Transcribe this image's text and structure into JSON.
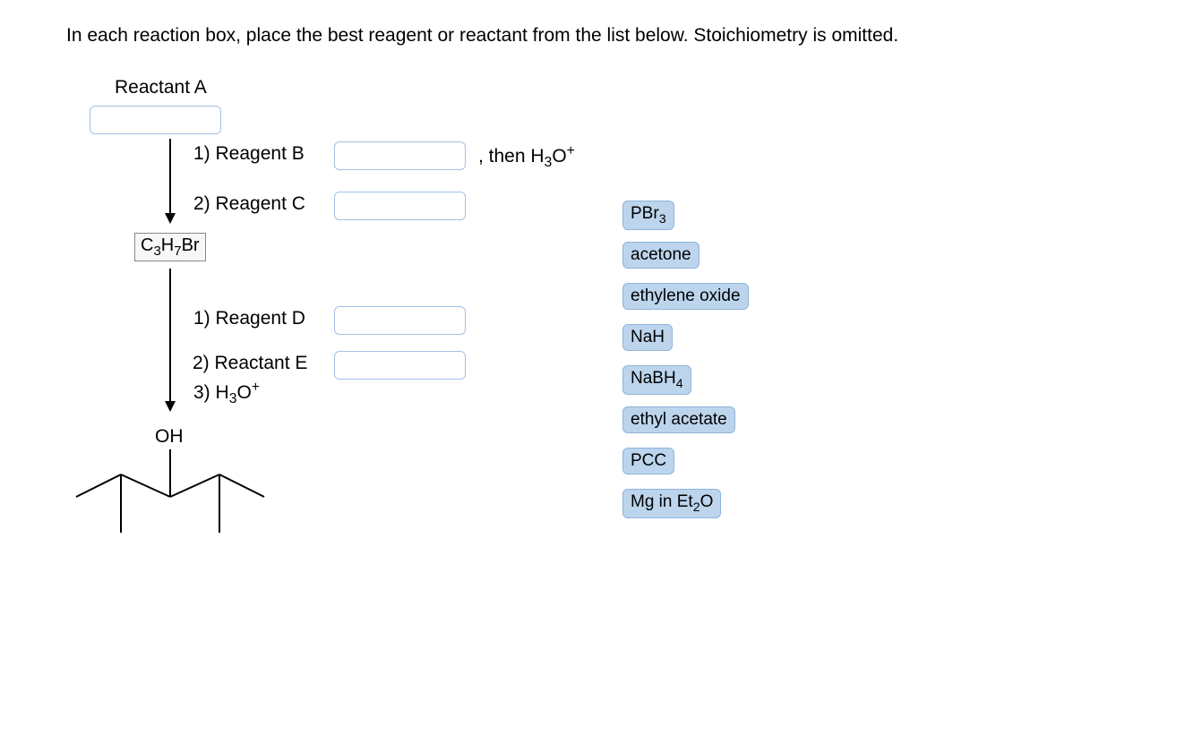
{
  "instruction": "In each reaction box, place the best reagent or reactant from the list below. Stoichiometry is omitted.",
  "labels": {
    "reactant_a": "Reactant A",
    "step_b_prefix": "1) Reagent B",
    "step_b_suffix": ", then H₃O⁺",
    "step_c": "2) Reagent C",
    "intermediate": "C₃H₇Br",
    "step_d": "1) Reagent D",
    "step_e": "2) Reactant E",
    "step_f": "3) H₃O⁺",
    "product_oh": "OH"
  },
  "reagent_bank": [
    "PBr₃",
    "acetone",
    "ethylene oxide",
    "NaH",
    "NaBH₄",
    "ethyl acetate",
    "PCC",
    "Mg in Et₂O"
  ],
  "answer_slots": {
    "A": "",
    "B": "",
    "C": "",
    "D": "",
    "E": ""
  }
}
